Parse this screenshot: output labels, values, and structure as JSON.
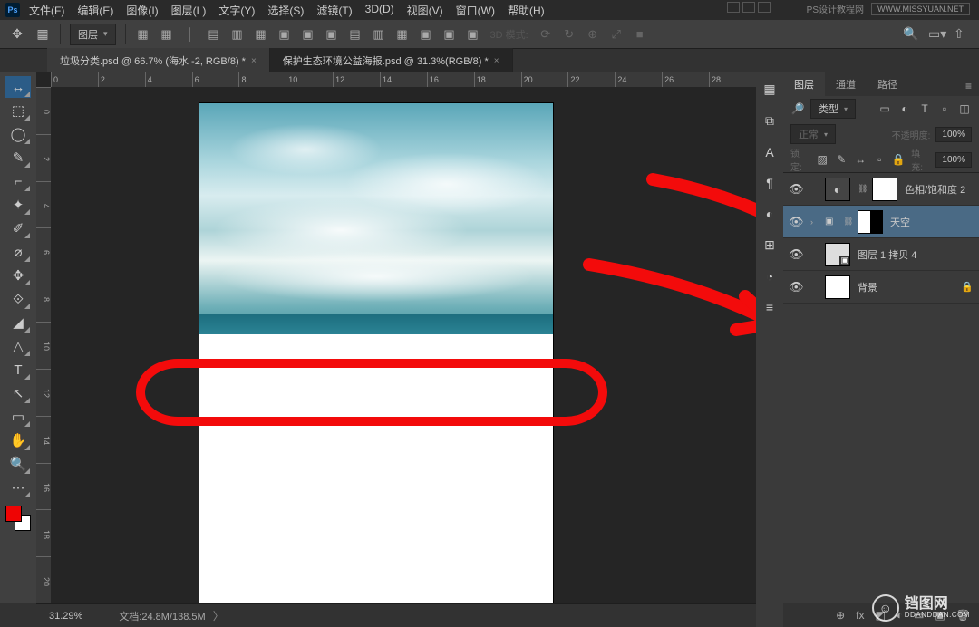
{
  "menu": [
    "文件(F)",
    "编辑(E)",
    "图像(I)",
    "图层(L)",
    "文字(Y)",
    "选择(S)",
    "滤镜(T)",
    "3D(D)",
    "视图(V)",
    "窗口(W)",
    "帮助(H)"
  ],
  "topWatermark": {
    "site": "PS设计教程网",
    "url": "WWW.MISSYUAN.NET"
  },
  "options": {
    "layerDD": "图层",
    "threeD": "3D 模式:"
  },
  "tabs": [
    {
      "label": "垃圾分类.psd @ 66.7% (海水 -2, RGB/8) *",
      "active": false
    },
    {
      "label": "保护生态环境公益海报.psd @ 31.3%(RGB/8) *",
      "active": true
    }
  ],
  "hRuler": [
    "0",
    "2",
    "4",
    "6",
    "8",
    "10",
    "12",
    "14",
    "16",
    "18",
    "20",
    "22",
    "24",
    "26",
    "28"
  ],
  "vRuler": [
    "0",
    "2",
    "4",
    "6",
    "8",
    "10",
    "12",
    "14",
    "16",
    "18",
    "20"
  ],
  "panel": {
    "tabs": [
      "图层",
      "通道",
      "路径"
    ],
    "typeFilter": "类型",
    "blend": "正常",
    "opacityLabel": "不透明度:",
    "opacity": "100%",
    "lockLabel": "锁定:",
    "fillLabel": "填充:",
    "fill": "100%"
  },
  "layers": [
    {
      "name": "色相/饱和度 2",
      "eye": true,
      "adj": true,
      "mask": true
    },
    {
      "name": "天空",
      "eye": true,
      "group": true,
      "mask": true,
      "underline": true,
      "sel": true
    },
    {
      "name": "图层 1 拷贝 4",
      "eye": true,
      "smart": true
    },
    {
      "name": "背景",
      "eye": true,
      "locked": true
    }
  ],
  "status": {
    "zoom": "31.29%",
    "doc": "文档:24.8M/138.5M"
  },
  "siteWM": {
    "zh": "铛图网",
    "en": "DDANDDAN.COM"
  },
  "rcolIcons": [
    "▦",
    "⧉",
    "A",
    "¶",
    "◐",
    "⊞",
    "◔",
    "≡"
  ],
  "tools": [
    "↔",
    "⬚",
    "◯",
    "✎",
    "⌐",
    "✦",
    "✐",
    "⌀",
    "✥",
    "⟐",
    "◢",
    "△",
    "T",
    "↖",
    "▭",
    "✋",
    "🔍",
    "⋯"
  ],
  "optIcons": [
    "▦",
    "▦",
    "│",
    "▤",
    "▥",
    "▦",
    "▣",
    "▣",
    "▣",
    "▤",
    "▥",
    "▦",
    "▣",
    "▣",
    "▣"
  ],
  "panelBtns": [
    "▭",
    "◐",
    "T",
    "▫",
    "◫"
  ],
  "lockBtns": [
    "▨",
    "✎",
    "↔",
    "▫",
    "🔒"
  ],
  "botIcons": [
    "⊕",
    "fx",
    "◩",
    "◐",
    "▭",
    "▣",
    "🗑"
  ]
}
